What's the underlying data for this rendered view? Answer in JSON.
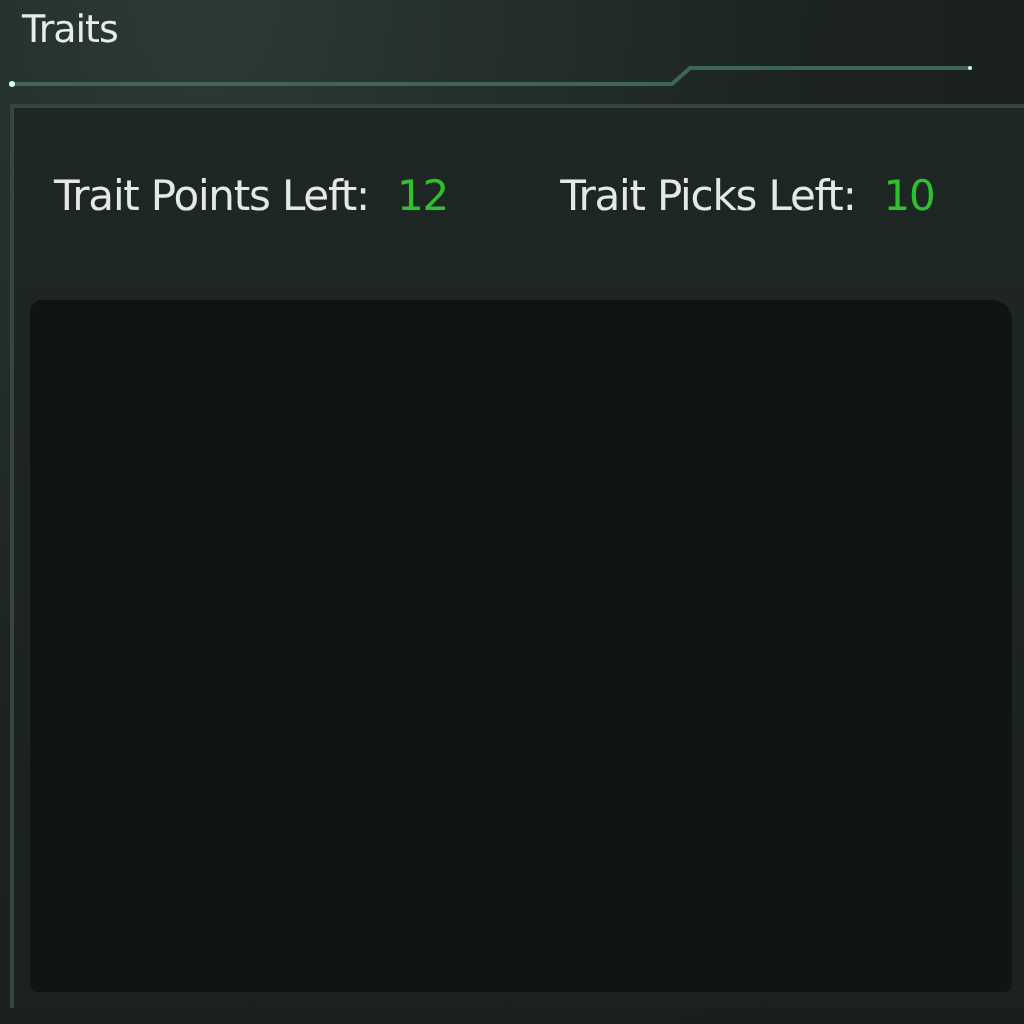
{
  "window": {
    "title": "Traits"
  },
  "stats": [
    {
      "label": "Trait Points Left:",
      "value": "12"
    },
    {
      "label": "Trait Picks Left:",
      "value": "10"
    }
  ]
}
